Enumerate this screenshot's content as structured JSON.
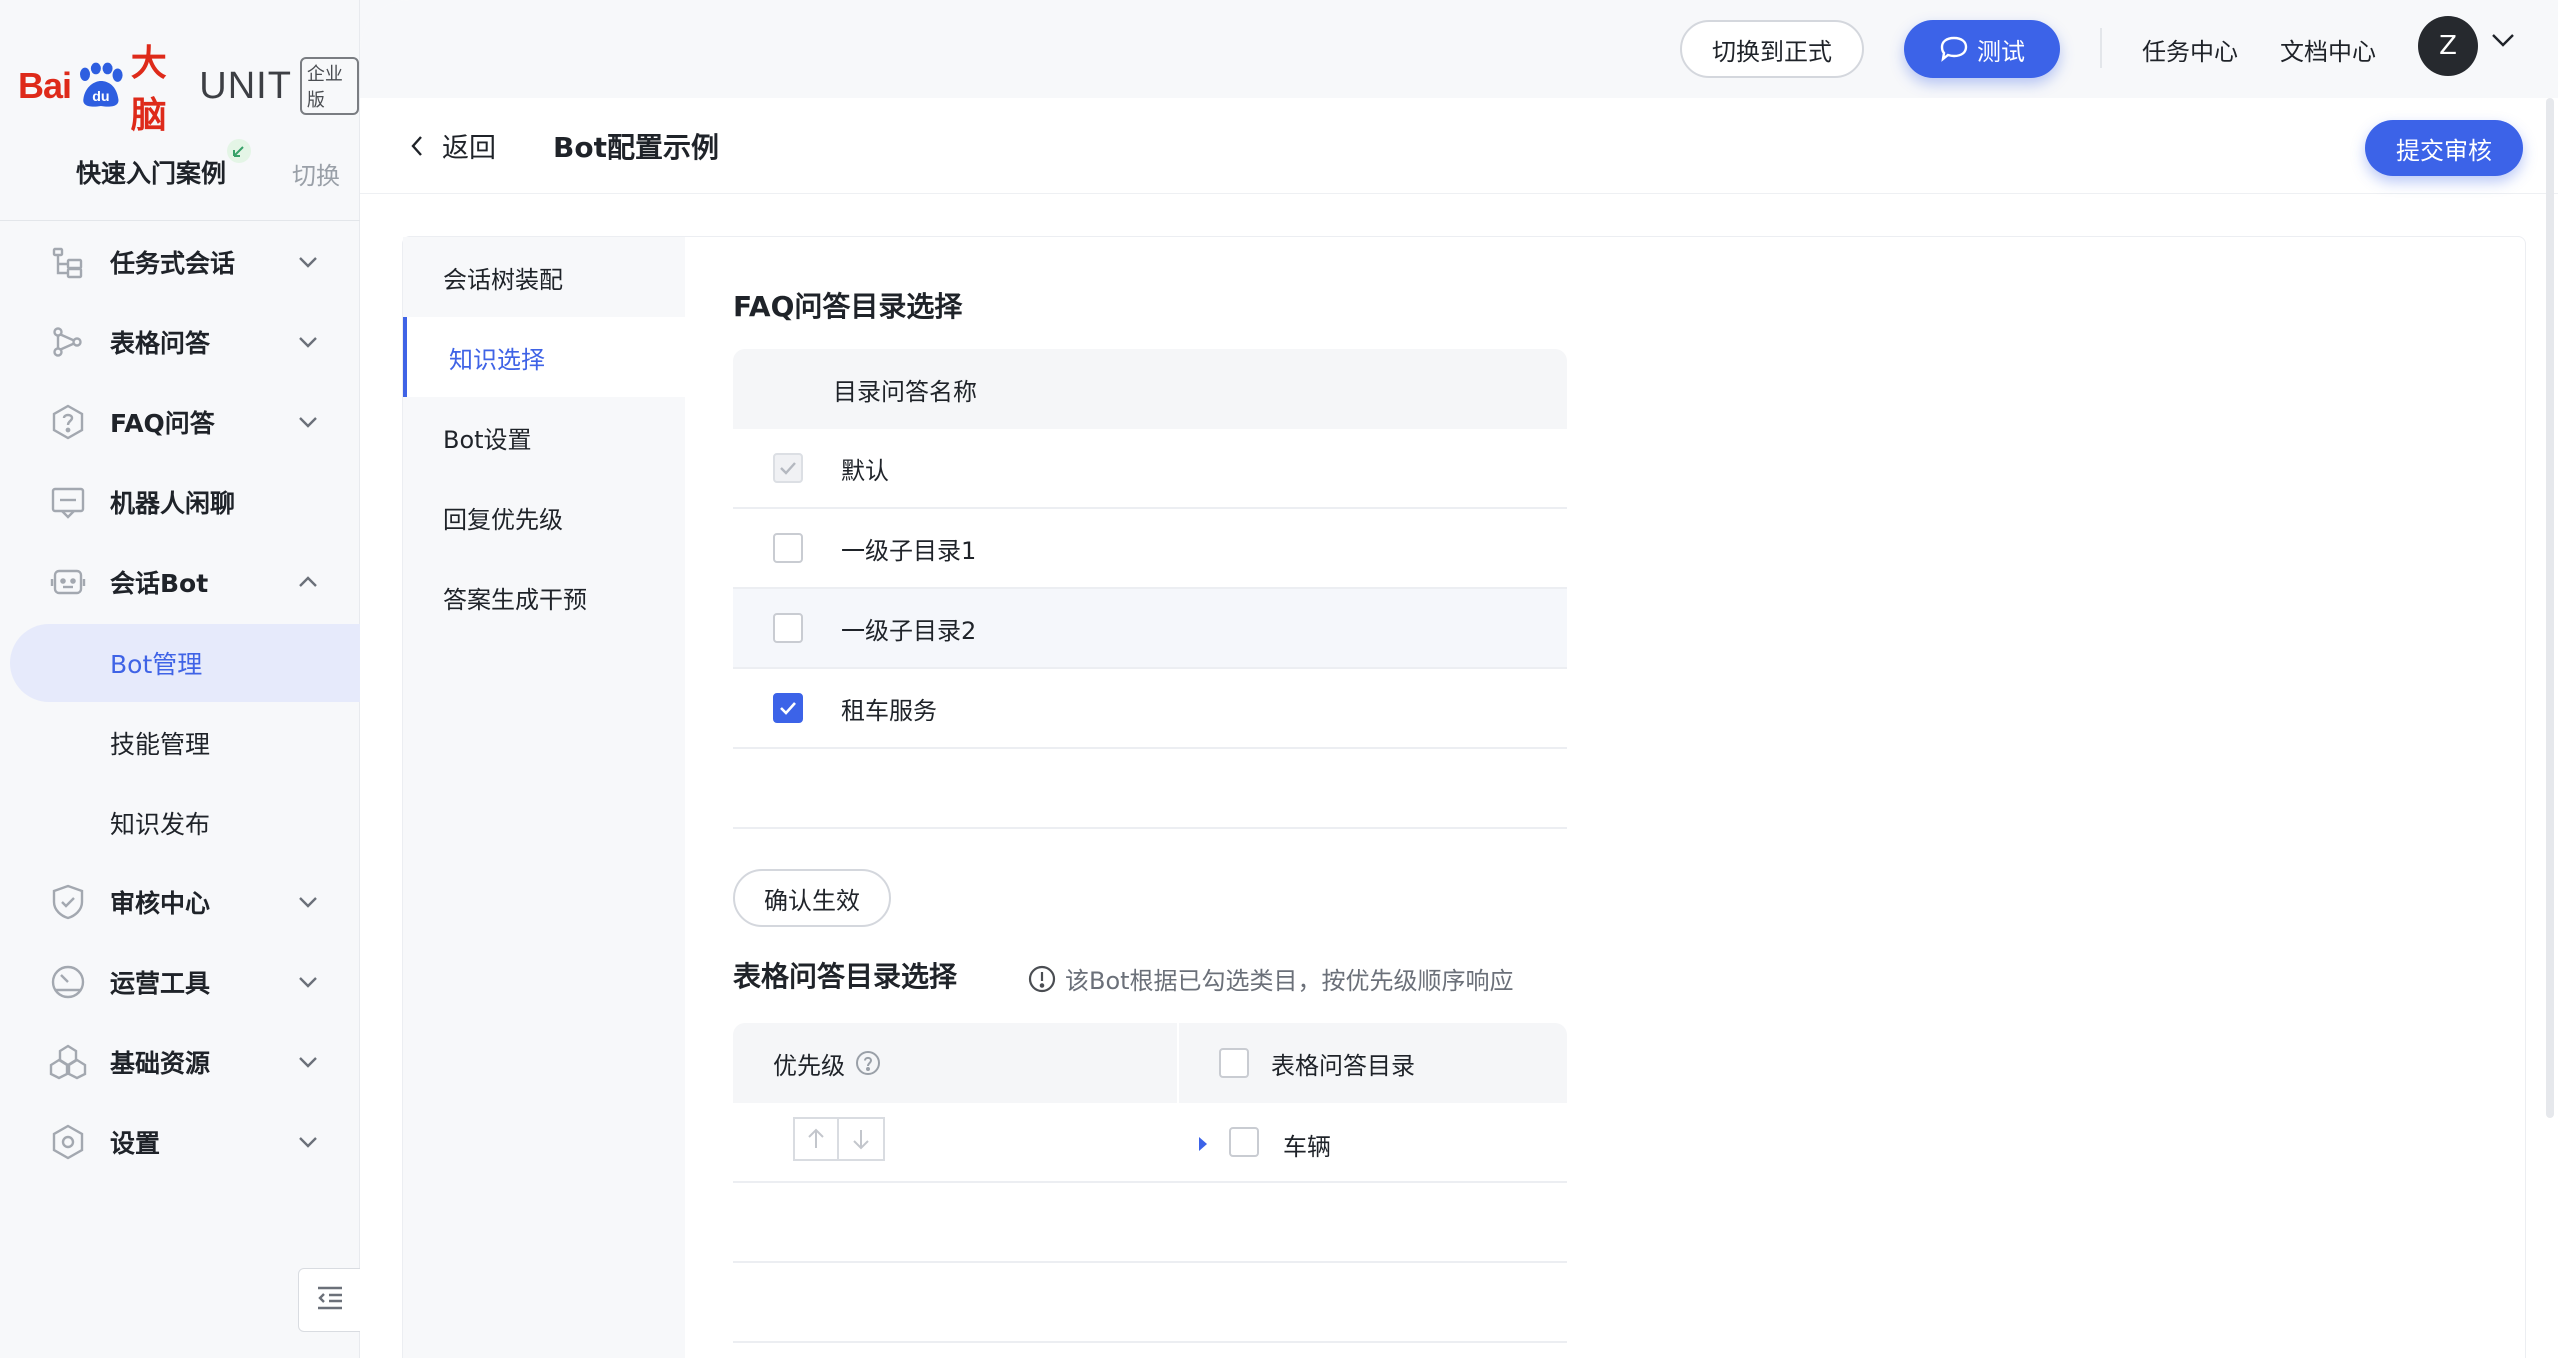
{
  "brand": {
    "logo_main": "Bai",
    "logo_du": "du",
    "logo_cn": "大脑",
    "product": "UNIT",
    "edition": "企业版"
  },
  "project": {
    "name": "快速入门案例",
    "switch_label": "切换"
  },
  "sidebar": {
    "items": [
      {
        "label": "任务式会话",
        "icon": "task-tree-icon",
        "expanded": false
      },
      {
        "label": "表格问答",
        "icon": "graph-nodes-icon",
        "expanded": false
      },
      {
        "label": "FAQ问答",
        "icon": "question-hexagon-icon",
        "expanded": false
      },
      {
        "label": "机器人闲聊",
        "icon": "chat-bubble-icon",
        "expanded": false
      },
      {
        "label": "会话Bot",
        "icon": "robot-icon",
        "expanded": true
      },
      {
        "label": "审核中心",
        "icon": "shield-check-icon",
        "expanded": false
      },
      {
        "label": "运营工具",
        "icon": "dashboard-icon",
        "expanded": false
      },
      {
        "label": "基础资源",
        "icon": "cubes-icon",
        "expanded": false
      },
      {
        "label": "设置",
        "icon": "gear-icon",
        "expanded": false
      }
    ],
    "bot_children": [
      {
        "label": "Bot管理",
        "active": true
      },
      {
        "label": "技能管理",
        "active": false
      },
      {
        "label": "知识发布",
        "active": false
      }
    ]
  },
  "topbar": {
    "switch_env": "切换到正式",
    "test": "测试",
    "task_center": "任务中心",
    "doc_center": "文档中心",
    "avatar_letter": "Z"
  },
  "header": {
    "back": "返回",
    "title": "Bot配置示例",
    "submit": "提交审核"
  },
  "subnav": [
    {
      "label": "会话树装配",
      "active": false
    },
    {
      "label": "知识选择",
      "active": true
    },
    {
      "label": "Bot设置",
      "active": false
    },
    {
      "label": "回复优先级",
      "active": false
    },
    {
      "label": "答案生成干预",
      "active": false
    }
  ],
  "faq": {
    "title": "FAQ问答目录选择",
    "column": "目录问答名称",
    "rows": [
      {
        "name": "默认",
        "checked": true,
        "disabled": true
      },
      {
        "name": "一级子目录1",
        "checked": false,
        "disabled": false
      },
      {
        "name": "一级子目录2",
        "checked": false,
        "disabled": false
      },
      {
        "name": "租车服务",
        "checked": true,
        "disabled": false
      }
    ],
    "confirm": "确认生效"
  },
  "table_qa": {
    "title": "表格问答目录选择",
    "note": "该Bot根据已勾选类目，按优先级顺序响应",
    "col_priority": "优先级",
    "col_catalog": "表格问答目录",
    "rows": [
      {
        "name": "车辆",
        "checked": false
      }
    ]
  },
  "colors": {
    "primary": "#3c63e8",
    "active_text": "#3f63e6",
    "active_bg": "#e6eafb",
    "brand_red": "#de2a1a"
  }
}
